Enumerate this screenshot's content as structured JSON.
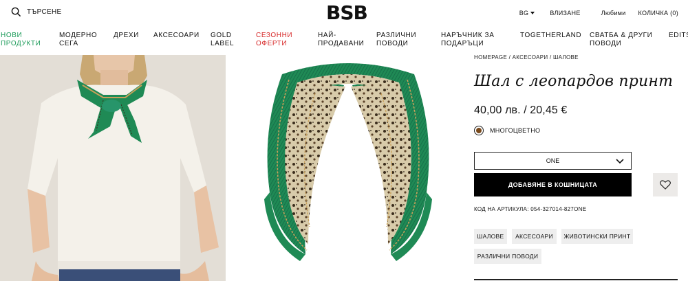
{
  "header": {
    "search_label": "ТЪРСЕНЕ",
    "logo": "BSB",
    "lang": "BG",
    "login": "ВЛИЗАНЕ",
    "favorites": "Любими",
    "cart": "КОЛИЧКА (0)"
  },
  "nav": [
    {
      "line1": "НОВИ",
      "line2": "ПРОДУКТИ",
      "color": "#1a9a58"
    },
    {
      "line1": "МОДЕРНО",
      "line2": "СЕГА"
    },
    {
      "line1": "ДРЕХИ",
      "line2": ""
    },
    {
      "line1": "АКСЕСОАРИ",
      "line2": ""
    },
    {
      "line1": "GOLD",
      "line2": "LABEL"
    },
    {
      "line1": "СЕЗОННИ",
      "line2": "ОФЕРТИ",
      "color": "#d72828"
    },
    {
      "line1": "НАЙ-",
      "line2": "ПРОДАВАНИ"
    },
    {
      "line1": "РАЗЛИЧНИ",
      "line2": "ПОВОДИ"
    },
    {
      "line1": "НАРЪЧНИК ЗА",
      "line2": "ПОДАРЪЦИ"
    },
    {
      "line1": "TOGETHERLAND",
      "line2": ""
    },
    {
      "line1": "СВАТБА & ДРУГИ",
      "line2": "ПОВОДИ"
    },
    {
      "line1": "EDITS",
      "line2": ""
    }
  ],
  "product": {
    "breadcrumb": [
      "HOMEPAGE",
      "АКСЕСОАРИ",
      "ШАЛОВЕ"
    ],
    "breadcrumb_sep": " / ",
    "title": "Шал с леопардов принт",
    "price": "40,00 лв. / 20,45 €",
    "color_name": "МНОГОЦВЕТНО",
    "color_hex": "#7a4a1c",
    "size_value": "ONE",
    "add_to_cart": "ДОБАВЯНЕ В КОШНИЦАТА",
    "code": "КОД НА АРТИКУЛА: 054-327014-827ONE",
    "tags": [
      "ШАЛОВЕ",
      "АКСЕСОАРИ",
      "ЖИВОТИНСКИ ПРИНТ",
      "РАЗЛИЧНИ ПОВОДИ"
    ]
  },
  "colors": {
    "accent_green": "#1a9a58",
    "sale_red": "#d72828",
    "scarf_green": "#1f8a55",
    "button_black": "#000000"
  }
}
